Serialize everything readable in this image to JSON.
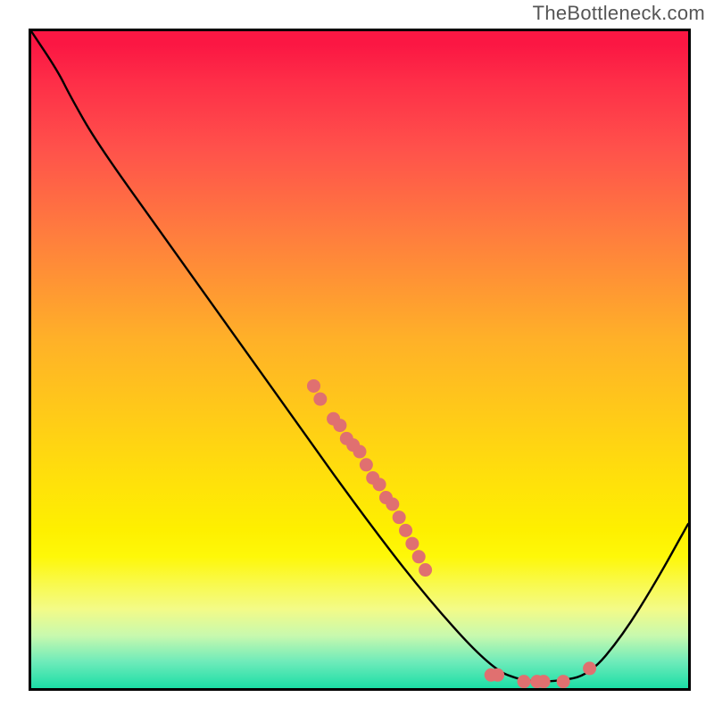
{
  "watermark": "TheBottleneck.com",
  "chart_data": {
    "type": "line",
    "title": "",
    "xlabel": "",
    "ylabel": "",
    "xlim": [
      0,
      100
    ],
    "ylim": [
      0,
      100
    ],
    "curve_note": "Bottleneck curve; y = 100 is max bottleneck (red), y = 0 is optimal (green). x is relative performance axis.",
    "curve": [
      {
        "x": 0,
        "y": 100
      },
      {
        "x": 4,
        "y": 94
      },
      {
        "x": 6,
        "y": 90
      },
      {
        "x": 10,
        "y": 83
      },
      {
        "x": 20,
        "y": 69
      },
      {
        "x": 30,
        "y": 55
      },
      {
        "x": 40,
        "y": 41
      },
      {
        "x": 50,
        "y": 27
      },
      {
        "x": 60,
        "y": 14
      },
      {
        "x": 70,
        "y": 3
      },
      {
        "x": 75,
        "y": 1
      },
      {
        "x": 80,
        "y": 1
      },
      {
        "x": 85,
        "y": 2
      },
      {
        "x": 90,
        "y": 8
      },
      {
        "x": 95,
        "y": 16
      },
      {
        "x": 100,
        "y": 25
      }
    ],
    "series": [
      {
        "name": "components",
        "points": [
          {
            "x": 43,
            "y": 46
          },
          {
            "x": 44,
            "y": 44
          },
          {
            "x": 46,
            "y": 41
          },
          {
            "x": 47,
            "y": 40
          },
          {
            "x": 48,
            "y": 38
          },
          {
            "x": 49,
            "y": 37
          },
          {
            "x": 50,
            "y": 36
          },
          {
            "x": 51,
            "y": 34
          },
          {
            "x": 52,
            "y": 32
          },
          {
            "x": 53,
            "y": 31
          },
          {
            "x": 54,
            "y": 29
          },
          {
            "x": 55,
            "y": 28
          },
          {
            "x": 56,
            "y": 26
          },
          {
            "x": 57,
            "y": 24
          },
          {
            "x": 58,
            "y": 22
          },
          {
            "x": 59,
            "y": 20
          },
          {
            "x": 60,
            "y": 18
          },
          {
            "x": 70,
            "y": 2
          },
          {
            "x": 71,
            "y": 2
          },
          {
            "x": 75,
            "y": 1
          },
          {
            "x": 77,
            "y": 1
          },
          {
            "x": 78,
            "y": 1
          },
          {
            "x": 81,
            "y": 1
          },
          {
            "x": 85,
            "y": 3
          }
        ]
      }
    ],
    "colors": {
      "curve": "#000000",
      "points": "#e07070",
      "gradient_top": "#fb1743",
      "gradient_bottom": "#1cdea6"
    }
  }
}
